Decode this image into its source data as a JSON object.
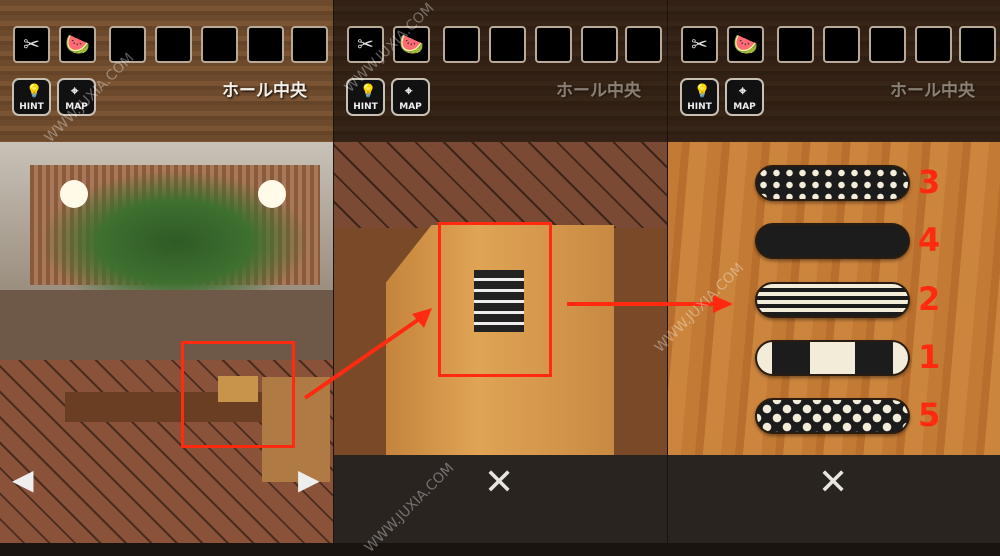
{
  "hud": {
    "location": "ホール中央",
    "hint_label": "HINT",
    "map_label": "MAP",
    "inventory": [
      {
        "item": "scissors-icon",
        "glyph": "✂"
      },
      {
        "item": "watermelon-icon",
        "glyph": "🍉"
      },
      {
        "item": ""
      },
      {
        "item": ""
      },
      {
        "item": ""
      },
      {
        "item": ""
      },
      {
        "item": ""
      }
    ]
  },
  "nav": {
    "left": "◀",
    "right": "▶",
    "close": "✕"
  },
  "puzzle": {
    "strips": [
      {
        "pattern": "polka-dots",
        "number": "3"
      },
      {
        "pattern": "solid-black",
        "number": "4"
      },
      {
        "pattern": "horizontal-stripes",
        "number": "2"
      },
      {
        "pattern": "black-white-blocks",
        "number": "1"
      },
      {
        "pattern": "flowers",
        "number": "5"
      }
    ]
  },
  "colors": {
    "annotation": "#ff2a10"
  },
  "watermark": "WWW.JUXIA.COM"
}
